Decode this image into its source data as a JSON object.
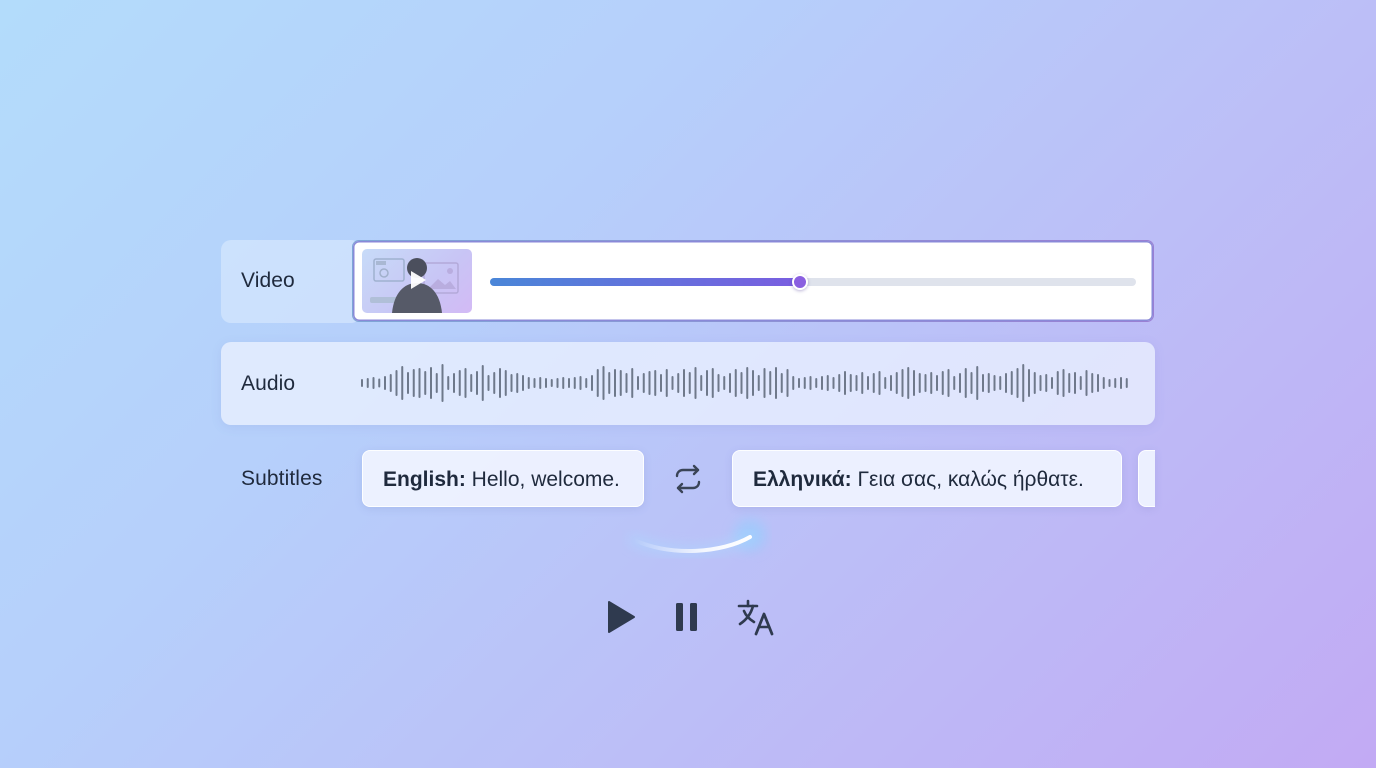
{
  "rows": {
    "video": {
      "label": "Video",
      "progress_percent": 48
    },
    "audio": {
      "label": "Audio",
      "waveform_bars": [
        8,
        10,
        12,
        9,
        14,
        18,
        26,
        34,
        22,
        28,
        30,
        24,
        32,
        20,
        38,
        14,
        20,
        26,
        30,
        18,
        24,
        36,
        16,
        22,
        30,
        26,
        18,
        20,
        16,
        12,
        10,
        12,
        10,
        8,
        10,
        12,
        10,
        12,
        14,
        10,
        16,
        28,
        34,
        22,
        28,
        26,
        20,
        30,
        14,
        20,
        24,
        26,
        18,
        28,
        14,
        20,
        28,
        22,
        32,
        16,
        26,
        30,
        18,
        14,
        20,
        28,
        22,
        32,
        26,
        16,
        30,
        24,
        32,
        20,
        28,
        14,
        10,
        12,
        14,
        10,
        14,
        16,
        12,
        18,
        24,
        18,
        16,
        22,
        14,
        20,
        24,
        12,
        16,
        22,
        28,
        32,
        26,
        20,
        18,
        22,
        16,
        24,
        28,
        14,
        20,
        30,
        22,
        34,
        18,
        20,
        16,
        14,
        20,
        24,
        30,
        38,
        28,
        22,
        16,
        18,
        12,
        24,
        28,
        20,
        22,
        14,
        26,
        20,
        18,
        12,
        8,
        10,
        12,
        10
      ],
      "bar_color": "#5b6577"
    },
    "subtitles": {
      "label": "Subtitles",
      "source": {
        "language": "English:",
        "text": "Hello, welcome."
      },
      "target": {
        "language": "Ελληνικά:",
        "text": "Γεια σας, καλώς ήρθατε."
      }
    }
  },
  "controls": {
    "play_icon": "play-icon",
    "pause_icon": "pause-icon",
    "translate_icon": "translate-icon"
  },
  "colors": {
    "accent_start": "#4a86d8",
    "accent_end": "#7a5ee0",
    "icon_color": "#2f3a4f"
  }
}
